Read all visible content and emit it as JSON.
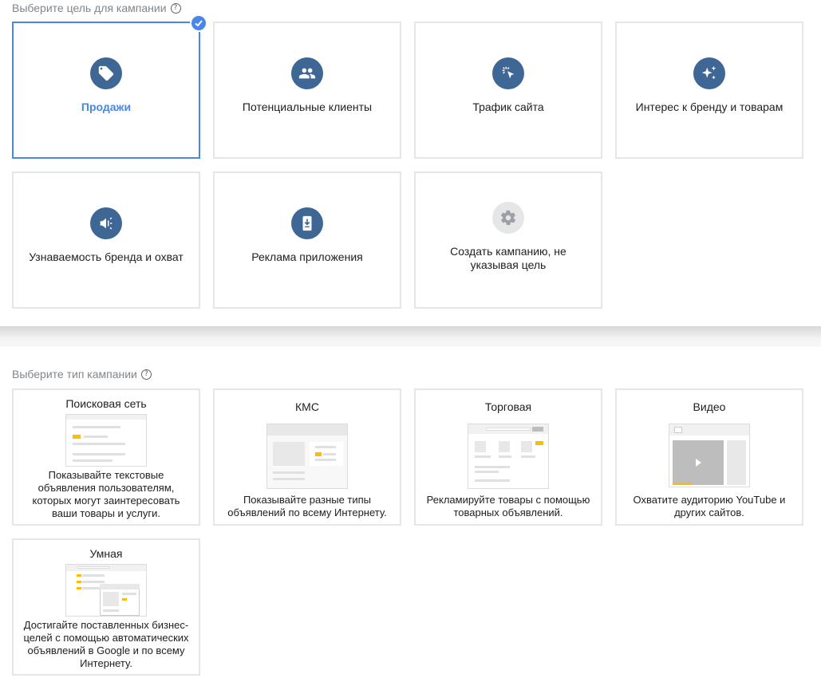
{
  "goals_section": {
    "label": "Выберите цель для кампании",
    "help": "?"
  },
  "goals": [
    {
      "label": "Продажи",
      "icon": "tag-icon",
      "selected": true
    },
    {
      "label": "Потенциальные клиенты",
      "icon": "people-icon",
      "selected": false
    },
    {
      "label": "Трафик сайта",
      "icon": "click-icon",
      "selected": false
    },
    {
      "label": "Интерес к бренду и товарам",
      "icon": "sparkle-icon",
      "selected": false
    },
    {
      "label": "Узнаваемость бренда и охват",
      "icon": "megaphone-icon",
      "selected": false
    },
    {
      "label": "Реклама приложения",
      "icon": "phone-download-icon",
      "selected": false
    },
    {
      "label": "Создать кампанию, не указывая цель",
      "icon": "gear-icon",
      "selected": false
    }
  ],
  "types_section": {
    "label": "Выберите тип кампании",
    "help": "?"
  },
  "types": [
    {
      "title": "Поисковая сеть",
      "desc": "Показывайте текстовые объявления пользователям, которых могут заинтересовать ваши товары и услуги."
    },
    {
      "title": "КМС",
      "desc": "Показывайте разные типы объявлений по всему Интернету."
    },
    {
      "title": "Торговая",
      "desc": "Рекламируйте товары с помощью товарных объявлений."
    },
    {
      "title": "Видео",
      "desc": "Охватите аудиторию YouTube и других сайтов."
    },
    {
      "title": "Умная",
      "desc": "Достигайте поставленных бизнес-целей с помощью автоматических объявлений в Google и по всему Интернету."
    }
  ],
  "colors": {
    "accent": "#4a86e8",
    "icon_bg": "#3f6796",
    "highlight": "#fbbc04"
  }
}
